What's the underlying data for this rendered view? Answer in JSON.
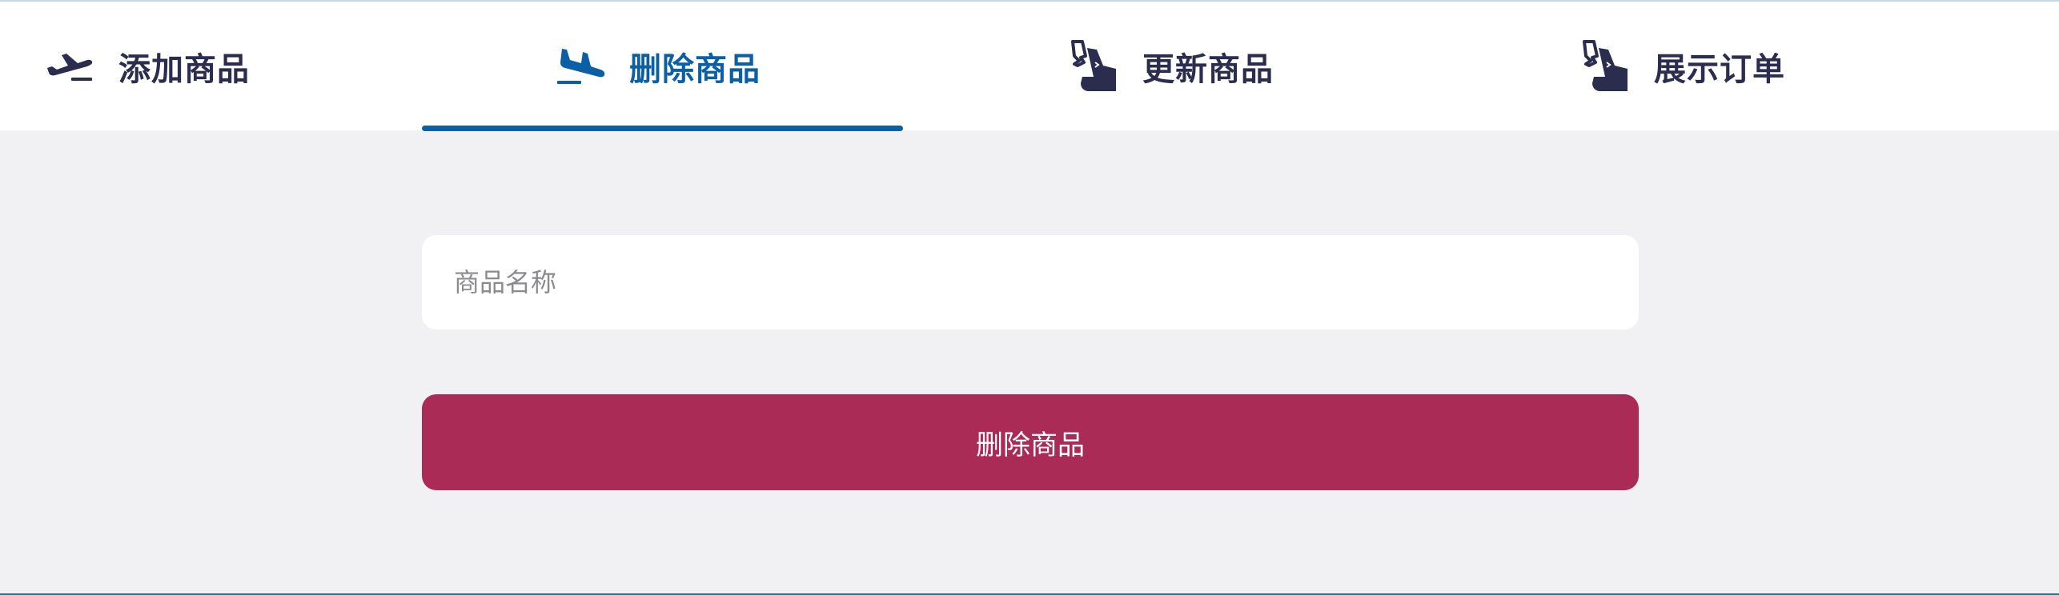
{
  "tabs": [
    {
      "label": "添加商品",
      "icon": "airplane-takeoff-icon",
      "active": false
    },
    {
      "label": "删除商品",
      "icon": "airplane-landing-icon",
      "active": true
    },
    {
      "label": "更新商品",
      "icon": "seat-icon",
      "active": false
    },
    {
      "label": "展示订单",
      "icon": "seat-icon",
      "active": false
    }
  ],
  "form": {
    "name_placeholder": "商品名称",
    "name_value": "",
    "submit_label": "删除商品"
  },
  "colors": {
    "active_tab": "#0b5fa5",
    "tab_text": "#2b2d4f",
    "button_bg": "#ab2b57",
    "page_bg": "#f1f1f3"
  }
}
